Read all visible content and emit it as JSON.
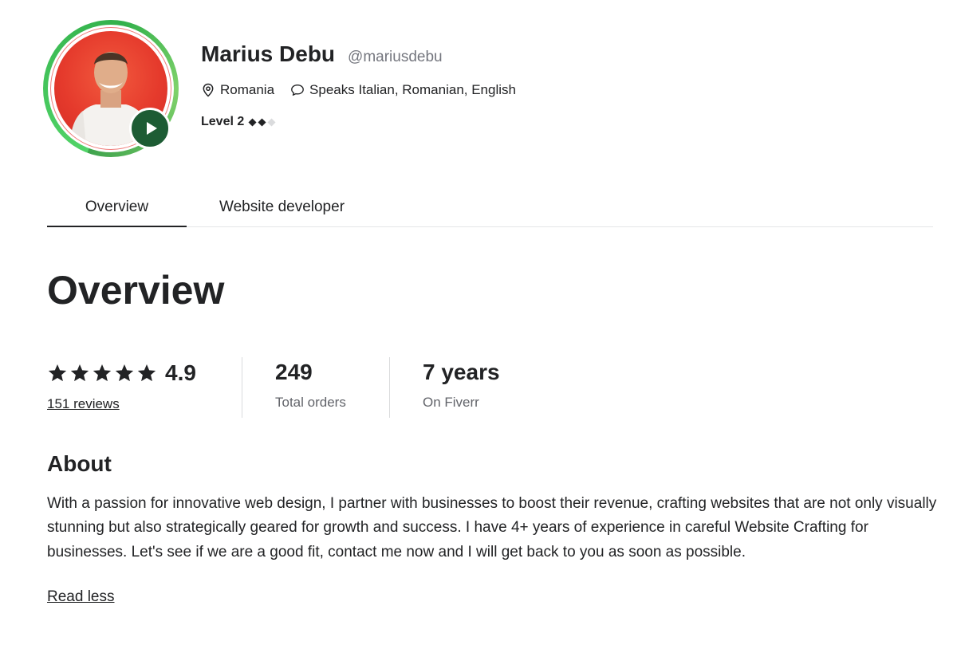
{
  "profile": {
    "name": "Marius Debu",
    "username": "@mariusdebu",
    "location": "Romania",
    "languages": "Speaks Italian, Romanian, English",
    "level": "Level 2",
    "level_filled": 2,
    "level_max": 3
  },
  "tabs": [
    {
      "label": "Overview",
      "active": true
    },
    {
      "label": "Website developer",
      "active": false
    }
  ],
  "overview": {
    "title": "Overview",
    "rating": {
      "stars": 5,
      "value": "4.9",
      "reviews": "151 reviews"
    },
    "stats": [
      {
        "value": "249",
        "label": "Total orders"
      },
      {
        "value": "7 years",
        "label": "On Fiverr"
      }
    ]
  },
  "about": {
    "title": "About",
    "text": "With a passion for innovative web design, I partner with businesses to boost their revenue, crafting websites that are not only visually stunning but also strategically geared for growth and success. I have 4+ years of experience in careful Website Crafting for businesses. Let's see if we are a good fit, contact me now and I will get back to you as soon as possible.",
    "toggle": "Read less"
  },
  "icons": {
    "location": "location-pin-icon",
    "languages": "speech-bubble-icon",
    "video": "play-icon",
    "rating": "star-icon",
    "level": "diamond-icon"
  },
  "colors": {
    "play_button": "#1d5c34",
    "ring": "#32b04b",
    "avatar_bg": "#e53a2c",
    "text": "#222325",
    "muted": "#74767e"
  }
}
